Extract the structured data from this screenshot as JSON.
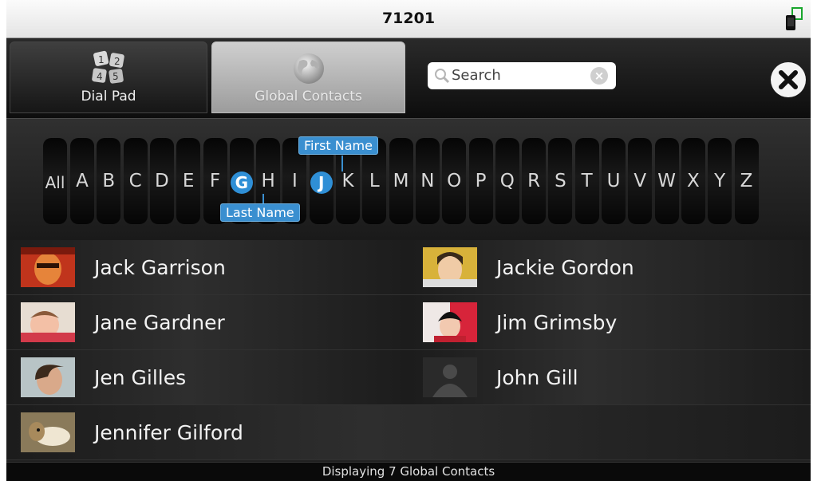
{
  "window": {
    "title": "71201",
    "device_icon": "phone-transfer-icon"
  },
  "tabs": [
    {
      "label": "Dial Pad",
      "icon": "dialpad-icon",
      "active": false
    },
    {
      "label": "Global Contacts",
      "icon": "globe-icon",
      "active": true
    }
  ],
  "search": {
    "placeholder": "Search",
    "search_icon": "search-icon",
    "clear_icon": "clear-icon"
  },
  "close_icon": "close-icon",
  "alphabet": {
    "letters": [
      "All",
      "A",
      "B",
      "C",
      "D",
      "E",
      "F",
      "G",
      "H",
      "I",
      "J",
      "K",
      "L",
      "M",
      "N",
      "O",
      "P",
      "Q",
      "R",
      "S",
      "T",
      "U",
      "V",
      "W",
      "X",
      "Y",
      "Z"
    ],
    "last_name_letter": "G",
    "first_name_letter": "J",
    "first_name_label": "First Name",
    "last_name_label": "Last Name"
  },
  "contacts": [
    {
      "name": "Jack Garrison"
    },
    {
      "name": "Jackie Gordon"
    },
    {
      "name": "Jane Gardner"
    },
    {
      "name": "Jim Grimsby"
    },
    {
      "name": "Jen Gilles"
    },
    {
      "name": "John Gill"
    },
    {
      "name": "Jennifer Gilford"
    }
  ],
  "status": "Displaying 7 Global Contacts",
  "colors": {
    "accent": "#2f8fd6",
    "background": "#000000"
  }
}
